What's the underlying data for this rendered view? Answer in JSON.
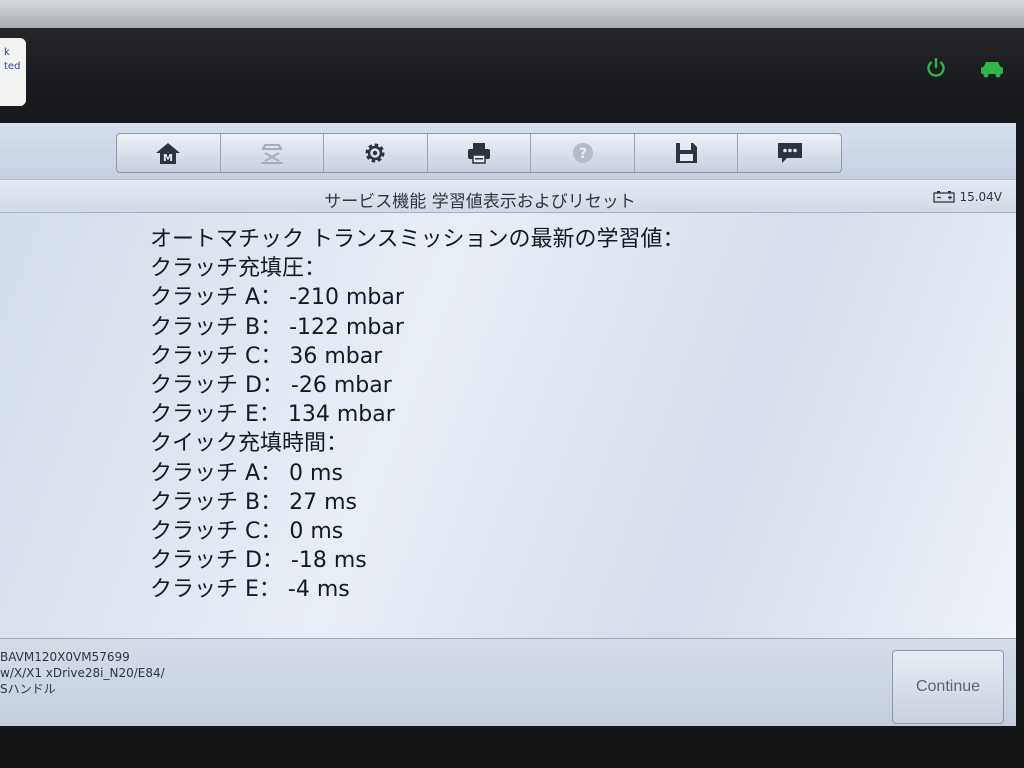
{
  "device": {
    "sticker_text": [
      "k",
      "ted"
    ],
    "status_icons": [
      {
        "icon": "power-icon",
        "color": "#2fb54a"
      },
      {
        "icon": "car-icon",
        "color": "#2fb54a"
      }
    ]
  },
  "toolbar": {
    "buttons": [
      {
        "icon": "home-icon"
      },
      {
        "icon": "vehicle-lift-icon"
      },
      {
        "icon": "gear-icon"
      },
      {
        "icon": "printer-icon"
      },
      {
        "icon": "help-icon"
      },
      {
        "icon": "save-icon"
      },
      {
        "icon": "message-icon"
      }
    ]
  },
  "header": {
    "title": "サービス機能 学習値表示およびリセット",
    "voltage": "15.04V"
  },
  "main": {
    "lines": [
      "オートマチック トランスミッションの最新の学習値：",
      "クラッチ充填圧：",
      "クラッチ A： -210 mbar",
      "クラッチ B： -122 mbar",
      "クラッチ C： 36 mbar",
      "クラッチ D： -26 mbar",
      "クラッチ E： 134 mbar",
      "クイック充填時間：",
      "クラッチ A： 0 ms",
      "クラッチ B： 27 ms",
      "クラッチ C： 0 ms",
      "クラッチ D： -18 ms",
      "クラッチ E： -4 ms"
    ]
  },
  "footer": {
    "vin": "BAVM120X0VM57699",
    "model": "w/X/X1 xDrive28i_N20/E84/",
    "steering": "Sハンドル",
    "continue_label": "Continue"
  },
  "colors": {
    "accent_green": "#2fb54a",
    "screen_bg": "#dfe7f2"
  }
}
